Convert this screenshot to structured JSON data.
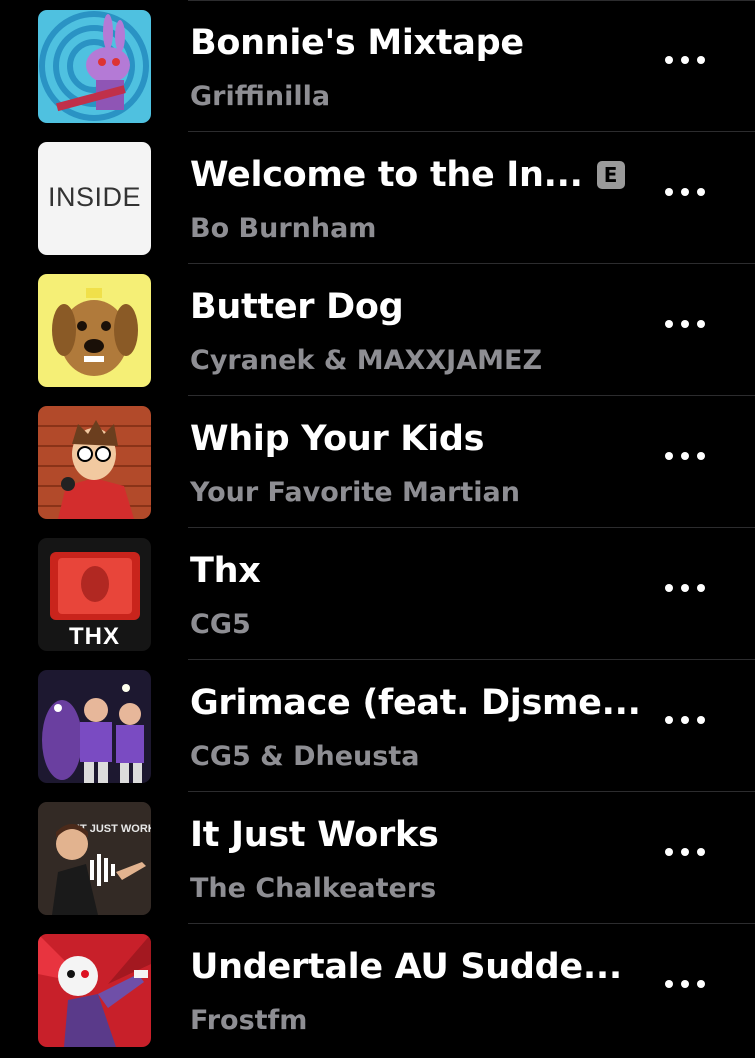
{
  "songs": [
    {
      "title": "Bonnie's Mixtape",
      "artist": "Griffinilla",
      "explicit": false,
      "artwork": "bonnie-artwork"
    },
    {
      "title": "Welcome to the In...",
      "artist": "Bo Burnham",
      "explicit": true,
      "explicit_label": "E",
      "artwork": "inside-artwork",
      "artwork_text": "INSIDE"
    },
    {
      "title": "Butter Dog",
      "artist": "Cyranek & MAXXJAMEZ",
      "explicit": false,
      "artwork": "dog-artwork"
    },
    {
      "title": "Whip Your Kids",
      "artist": "Your Favorite Martian",
      "explicit": false,
      "artwork": "martian-artwork"
    },
    {
      "title": "Thx",
      "artist": "CG5",
      "explicit": false,
      "artwork": "thx-artwork",
      "artwork_text": "THX"
    },
    {
      "title": "Grimace (feat. Djsme...",
      "artist": "CG5 & Dheusta",
      "explicit": false,
      "artwork": "grimace-artwork"
    },
    {
      "title": "It Just Works",
      "artist": "The Chalkeaters",
      "explicit": false,
      "artwork": "itjustworks-artwork",
      "artwork_text": "IT JUST WORKS"
    },
    {
      "title": "Undertale AU Sudde...",
      "artist": "Frostfm",
      "explicit": false,
      "artwork": "undertale-artwork"
    }
  ],
  "more_icon": "ellipsis-icon",
  "colors": {
    "background": "#000000",
    "title": "#ffffff",
    "artist": "#8e8e93",
    "divider": "#2c2c2e",
    "explicit_badge": "#9a9a9a"
  }
}
